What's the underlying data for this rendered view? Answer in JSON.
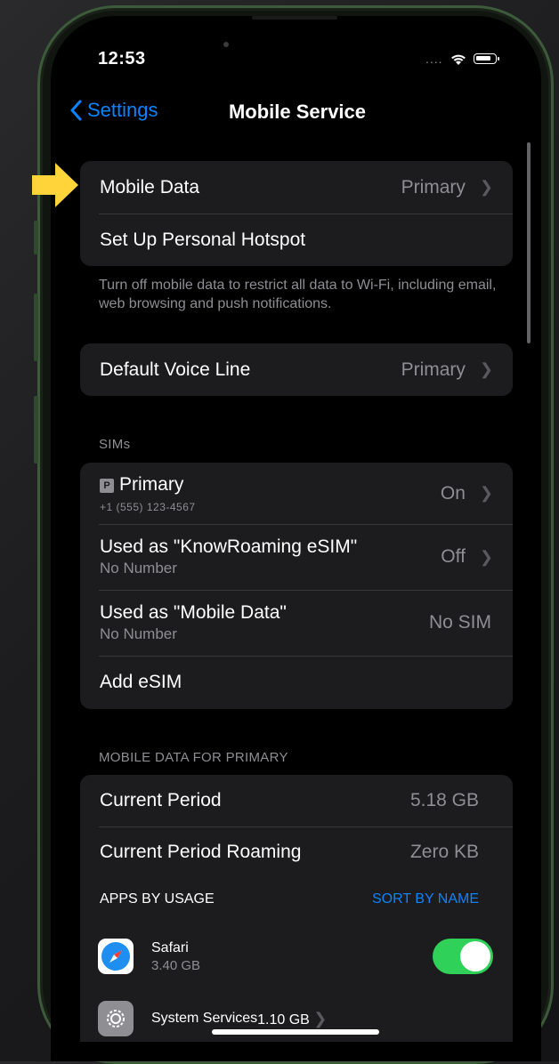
{
  "status_bar": {
    "time": "12:53",
    "signal_dots": "...."
  },
  "nav": {
    "back_label": "Settings",
    "title": "Mobile Service"
  },
  "group1": {
    "mobile_data_label": "Mobile Data",
    "mobile_data_value": "Primary",
    "hotspot_label": "Set Up Personal Hotspot"
  },
  "group1_footer": "Turn off mobile data to restrict all data to Wi-Fi, including email, web browsing and push notifications.",
  "voice": {
    "label": "Default Voice Line",
    "value": "Primary"
  },
  "sims": {
    "header": "SIMs",
    "items": [
      {
        "badge": "P",
        "title": "Primary",
        "subtitle": "+1 (555) 123-4567",
        "value": "On"
      },
      {
        "title": "Used as \"KnowRoaming eSIM\"",
        "subtitle": "No Number",
        "value": "Off"
      },
      {
        "title": "Used as \"Mobile Data\"",
        "subtitle": "No Number",
        "value": "No SIM"
      }
    ],
    "add_label": "Add eSIM"
  },
  "usage": {
    "header": "MOBILE DATA FOR PRIMARY",
    "current_period_label": "Current Period",
    "current_period_value": "5.18 GB",
    "roaming_label": "Current Period Roaming",
    "roaming_value": "Zero KB",
    "apps_header": "APPS BY USAGE",
    "sort_label": "SORT BY NAME",
    "apps": [
      {
        "name": "Safari",
        "usage": "3.40 GB",
        "enabled": true,
        "icon": "safari-icon"
      },
      {
        "name": "System Services",
        "value": "1.10 GB",
        "icon": "gear-icon"
      }
    ]
  },
  "colors": {
    "accent": "#0a84ff",
    "toggle_on": "#30d158",
    "arrow": "#ffd43b",
    "frame": "#3d5a3a"
  }
}
